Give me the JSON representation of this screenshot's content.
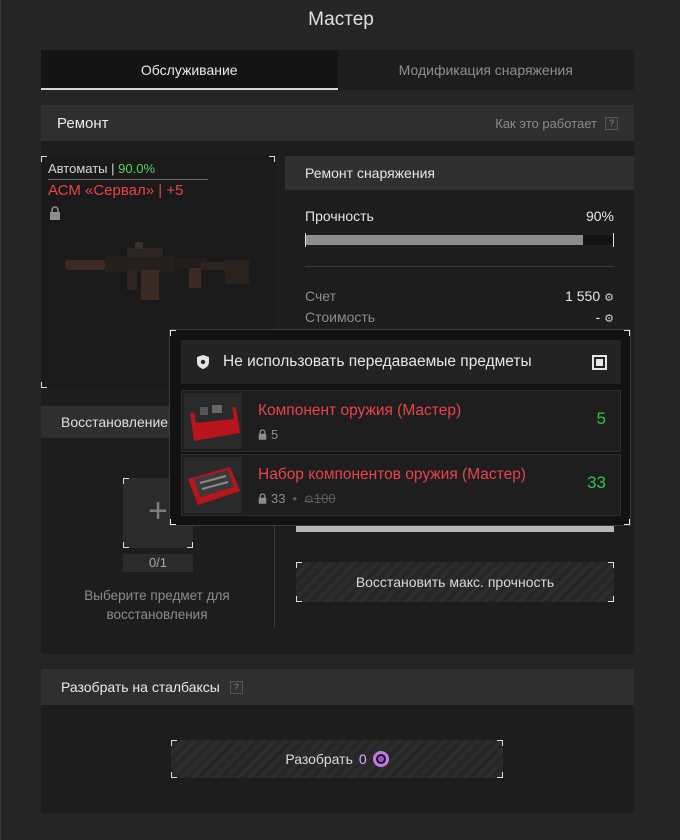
{
  "window": {
    "title": "Мастер"
  },
  "tabs": [
    {
      "label": "Обслуживание",
      "active": true
    },
    {
      "label": "Модификация снаряжения",
      "active": false
    }
  ],
  "repair": {
    "title": "Ремонт",
    "help_label": "Как это работает",
    "help_icon": "?"
  },
  "item": {
    "category": "Автоматы",
    "separator": "|",
    "condition": "90.0%",
    "name": "АСМ «Сервал» | +5"
  },
  "equipment_repair": {
    "title": "Ремонт снаряжения",
    "durability_label": "Прочность",
    "durability_value": "90%",
    "durability_fraction": 0.9,
    "account_label": "Счет",
    "account_value": "1 550",
    "cost_label": "Стоимость",
    "cost_value": "-"
  },
  "restoration": {
    "title": "Восстановление",
    "slot_count": "0/1",
    "hint": "Выберите предмет для восстановления",
    "button_label": "Восстановить макс. прочность"
  },
  "disassemble": {
    "title": "Разобрать на сталбаксы",
    "help_icon": "?",
    "button_label": "Разобрать",
    "button_value": "0"
  },
  "popup": {
    "header": "Не использовать передаваемые предметы",
    "checked": true,
    "items": [
      {
        "name": "Компонент оружия (Мастер)",
        "locked": "5",
        "count": "5"
      },
      {
        "name": "Набор компонентов оружия (Мастер)",
        "locked": "33",
        "struck": "100",
        "count": "33"
      }
    ]
  },
  "colors": {
    "accent_red": "#e9424a",
    "accent_green": "#35c04a",
    "condition_green": "#59d25b"
  },
  "icons": [
    "lock-icon",
    "shield-icon",
    "gear-coin-icon",
    "plus-icon",
    "stalbucks-coin-icon"
  ]
}
